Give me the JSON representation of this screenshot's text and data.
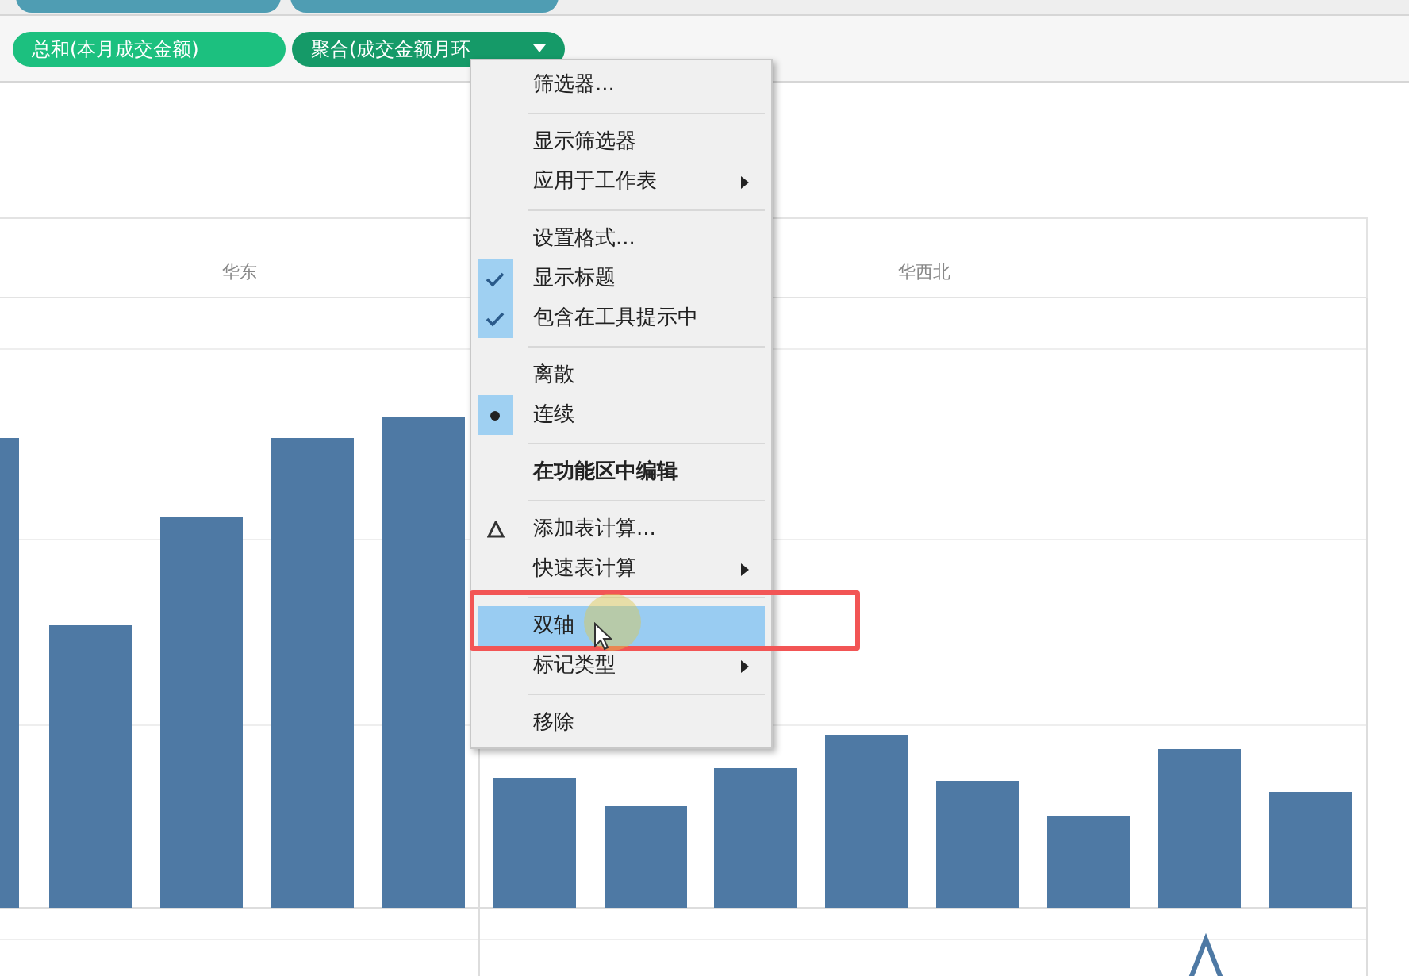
{
  "pills": [
    {
      "label": "总和(本月成交金额)",
      "kind": "measure"
    },
    {
      "label": "聚合(成交金额月环",
      "kind": "active"
    }
  ],
  "headers": [
    "华东",
    "华西北"
  ],
  "menu": [
    {
      "kind": "item",
      "label": "筛选器...",
      "submenu": false,
      "selected": false,
      "bold": false
    },
    {
      "kind": "separator"
    },
    {
      "kind": "item",
      "label": "显示筛选器",
      "submenu": false,
      "selected": false,
      "bold": false
    },
    {
      "kind": "item",
      "label": "应用于工作表",
      "submenu": true,
      "selected": false,
      "bold": false
    },
    {
      "kind": "separator"
    },
    {
      "kind": "item",
      "label": "设置格式...",
      "submenu": false,
      "selected": false,
      "bold": false
    },
    {
      "kind": "check",
      "label": "显示标题",
      "checked": true,
      "submenu": false,
      "selected": false,
      "bold": false
    },
    {
      "kind": "check",
      "label": "包含在工具提示中",
      "checked": true,
      "submenu": false,
      "selected": false,
      "bold": false
    },
    {
      "kind": "separator"
    },
    {
      "kind": "radio",
      "label": "离散",
      "checked": false,
      "submenu": false,
      "selected": false,
      "bold": false
    },
    {
      "kind": "radio",
      "label": "连续",
      "checked": true,
      "submenu": false,
      "selected": false,
      "bold": false
    },
    {
      "kind": "separator"
    },
    {
      "kind": "item",
      "label": "在功能区中编辑",
      "submenu": false,
      "selected": false,
      "bold": true
    },
    {
      "kind": "separator"
    },
    {
      "kind": "delta",
      "label": "添加表计算...",
      "submenu": false,
      "selected": false,
      "bold": false
    },
    {
      "kind": "item",
      "label": "快速表计算",
      "submenu": true,
      "selected": false,
      "bold": false
    },
    {
      "kind": "separator"
    },
    {
      "kind": "item",
      "label": "双轴",
      "submenu": false,
      "selected": true,
      "bold": false
    },
    {
      "kind": "item",
      "label": "标记类型",
      "submenu": true,
      "selected": false,
      "bold": false
    },
    {
      "kind": "separator"
    },
    {
      "kind": "item",
      "label": "移除",
      "submenu": false,
      "selected": false,
      "bold": false
    }
  ]
}
